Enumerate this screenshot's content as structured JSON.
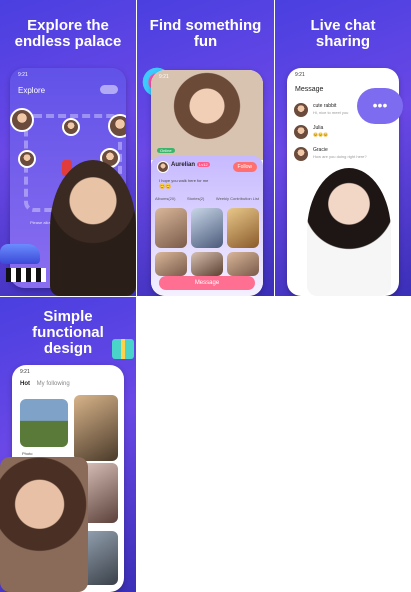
{
  "panels": [
    {
      "title": "Explore the\nendless palace",
      "screen_title": "Explore",
      "time": "9:21",
      "hint": "Please allow discovery of app usage"
    },
    {
      "title": "Find something\nfun",
      "time": "9:21",
      "user_name": "Aurelian",
      "badge": "Lv12",
      "follow": "Follow",
      "greeting": "I hope you walk here for me",
      "emoji": "😊😊",
      "tabs": [
        "Albums(20)",
        "Stories(2)",
        "Weekly Contribution List"
      ],
      "message_button": "Message",
      "online": "Online"
    },
    {
      "title": "Live chat\nsharing",
      "time": "9:21",
      "header": "Message",
      "chats": [
        {
          "name": "cute rabbit",
          "preview": "Hi, nice to meet you"
        },
        {
          "name": "Julia",
          "preview": "😊😊😊"
        },
        {
          "name": "Gracie",
          "preview": "How are you doing right here?"
        }
      ]
    },
    {
      "title": "Simple\nfunctional\ndesign",
      "time": "9:21",
      "tabs": [
        "Hot",
        "My following"
      ],
      "caption": "Photo"
    }
  ],
  "colors": {
    "accent": "#5a45e6",
    "pink": "#ff5a8a",
    "bubble": "#7d6cf0"
  }
}
